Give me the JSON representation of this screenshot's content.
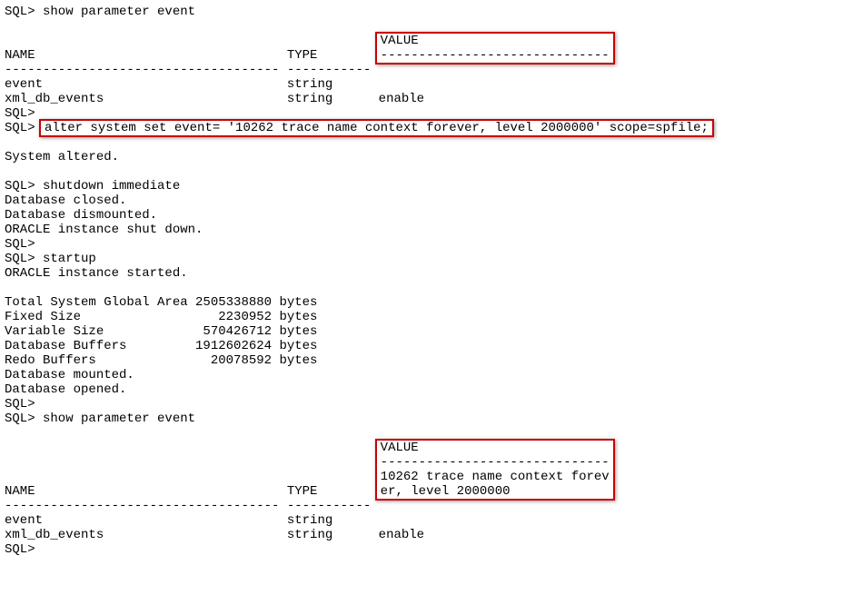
{
  "lines": {
    "0": "SQL> show parameter event",
    "1": "NAME                                 TYPE        ",
    "2": "VALUE",
    "3": "------------------------------",
    "4": "------------------------------------ ----------- ",
    "5": "event                                string",
    "6": "xml_db_events                        string      enable",
    "7": "SQL>\nSQL> ",
    "8": "alter system set event= '10262 trace name context forever, level 2000000' scope=spfile;",
    "9": "System altered.",
    "10": "SQL> shutdown immediate",
    "11": "Database closed.",
    "12": "Database dismounted.",
    "13": "ORACLE instance shut down.",
    "14": "SQL>",
    "15": "SQL> startup",
    "16": "ORACLE instance started.",
    "17": "Total System Global Area 2505338880 bytes",
    "18": "Fixed Size                  2230952 bytes",
    "19": "Variable Size             570426712 bytes",
    "20": "Database Buffers         1912602624 bytes",
    "21": "Redo Buffers               20078592 bytes",
    "22": "Database mounted.",
    "23": "Database opened.",
    "24": "SQL>",
    "25": "SQL> show parameter event",
    "26": "NAME                                 TYPE        ",
    "27": "VALUE",
    "28": "------------------------------",
    "29": "10262 trace name context forev",
    "30": "er, level 2000000",
    "31": "------------------------------------ ----------- ",
    "32": "event                                string      \nxml_db_events                        string      enable",
    "33": "SQL>"
  }
}
